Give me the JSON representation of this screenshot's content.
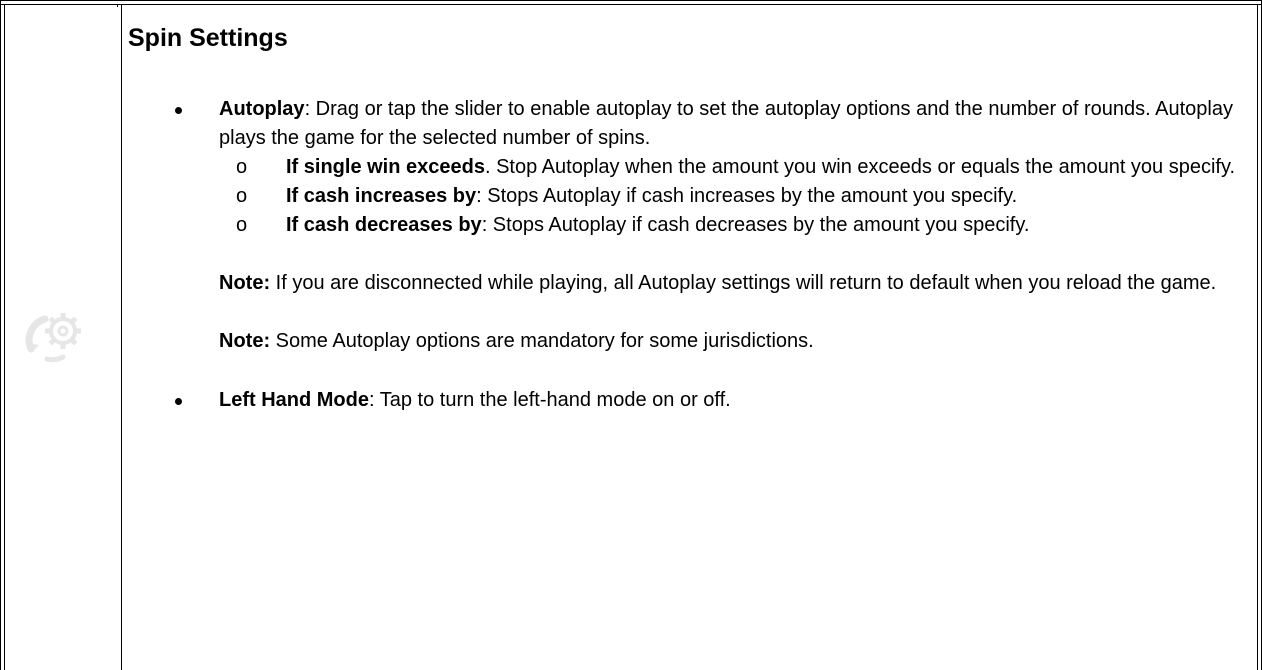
{
  "section": {
    "title": "Spin Settings",
    "icon": "spin-settings-icon"
  },
  "bullets": [
    {
      "term": "Autoplay",
      "text": ": Drag or tap the slider to enable autoplay to set the autoplay options and the number of rounds. Autoplay plays the game for the selected number of spins.",
      "sub": [
        {
          "marker": "o",
          "term": "If single win exceeds",
          "text": ". Stop Autoplay when the amount you win exceeds or equals the amount you specify."
        },
        {
          "marker": "o",
          "term": "If cash increases by",
          "text": ": Stops Autoplay if cash increases by the amount you specify."
        },
        {
          "marker": "o",
          "term": "If cash decreases by",
          "text": ": Stops Autoplay if cash decreases by the amount you specify."
        }
      ],
      "notes": [
        {
          "label": "Note:",
          "text": " If you are disconnected while playing, all Autoplay settings will return to default when you reload the game."
        },
        {
          "label": "Note:",
          "text": " Some Autoplay options are mandatory for some jurisdictions."
        }
      ]
    },
    {
      "term": "Left Hand Mode",
      "text": ": Tap to turn the left-hand mode on or off."
    }
  ],
  "colors": {
    "border": "#000000",
    "icon": "#e6e6e6",
    "background": "#ffffff"
  }
}
